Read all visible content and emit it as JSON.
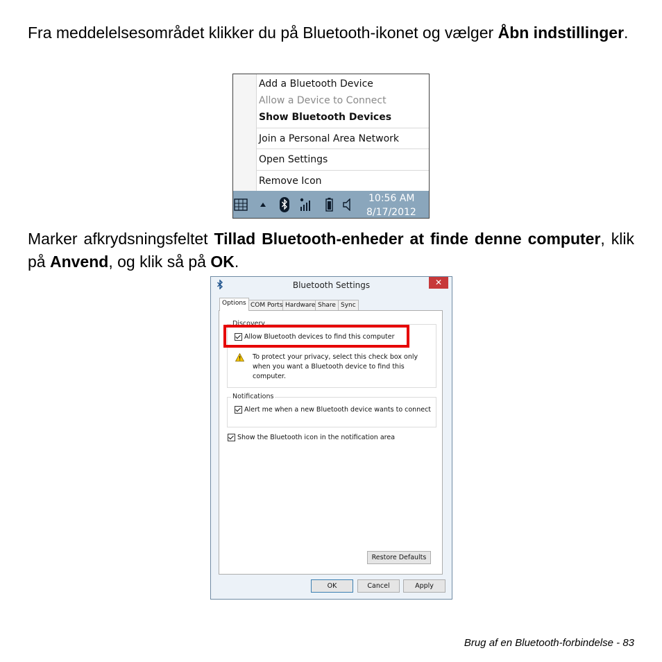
{
  "para1": {
    "text": "Fra meddelelsesområdet klikker du på Bluetooth-ikonet og vælger ",
    "bold": "Åbn indstillinger",
    "end": "."
  },
  "menu": {
    "items": [
      {
        "label": "Add a Bluetooth Device"
      },
      {
        "label": "Allow a Device to Connect"
      },
      {
        "label": "Show Bluetooth Devices"
      },
      {
        "label": "Join a Personal Area Network"
      },
      {
        "label": "Open Settings"
      },
      {
        "label": "Remove Icon"
      }
    ],
    "taskbar": {
      "time": "10:56 AM",
      "date": "8/17/2012"
    }
  },
  "para2": {
    "t1": "Marker afkrydsningsfeltet ",
    "b1": "Tillad Bluetooth-enheder at finde denne computer",
    "t2": ", klik på ",
    "b2": "Anvend",
    "t3": ", og klik så på ",
    "b3": "OK",
    "t4": "."
  },
  "dialog": {
    "title": "Bluetooth Settings",
    "close": "✕",
    "tabs": [
      "Options",
      "COM Ports",
      "Hardware",
      "Share",
      "Sync"
    ],
    "discovery": {
      "label": "Discovery",
      "checkbox": "Allow Bluetooth devices to find this computer",
      "warning": "To protect your privacy, select this check box only when you want a Bluetooth device to find this computer."
    },
    "notifications": {
      "label": "Notifications",
      "checkbox": "Alert me when a new Bluetooth device wants to connect"
    },
    "show_icon": "Show the Bluetooth icon in the notification area",
    "buttons": {
      "restore": "Restore Defaults",
      "ok": "OK",
      "cancel": "Cancel",
      "apply": "Apply"
    }
  },
  "footer": "Brug af en Bluetooth-forbindelse -  83"
}
